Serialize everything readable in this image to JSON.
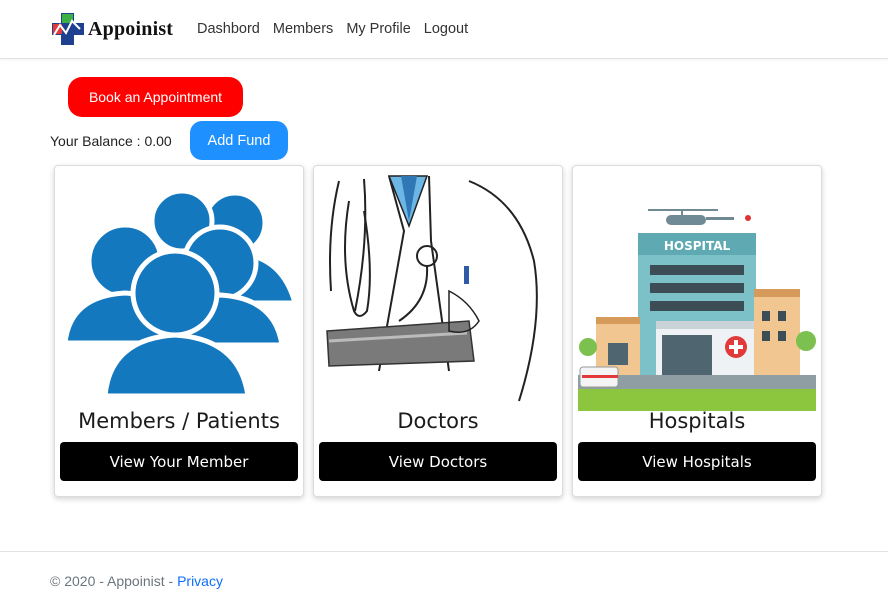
{
  "brand": {
    "name": "Appoinist"
  },
  "nav": [
    {
      "label": "Dashbord"
    },
    {
      "label": "Members"
    },
    {
      "label": "My Profile"
    },
    {
      "label": "Logout"
    }
  ],
  "actions": {
    "book_label": "Book an Appointment",
    "balance_text": "Your Balance : 0.00",
    "add_fund_label": "Add Fund"
  },
  "cards": [
    {
      "title": "Members / Patients",
      "button": "View Your Member",
      "icon": "people-group-icon"
    },
    {
      "title": "Doctors",
      "button": "View Doctors",
      "icon": "doctor-illustration"
    },
    {
      "title": "Hospitals",
      "button": "View Hospitals",
      "icon": "hospital-illustration",
      "sign": "HOSPITAL"
    }
  ],
  "footer": {
    "copyright": "© 2020 - Appoinist - ",
    "link": "Privacy"
  },
  "colors": {
    "book_button": "#ff0000",
    "fund_button": "#1e90ff",
    "card_button": "#000000",
    "people_icon": "#1478bf"
  }
}
